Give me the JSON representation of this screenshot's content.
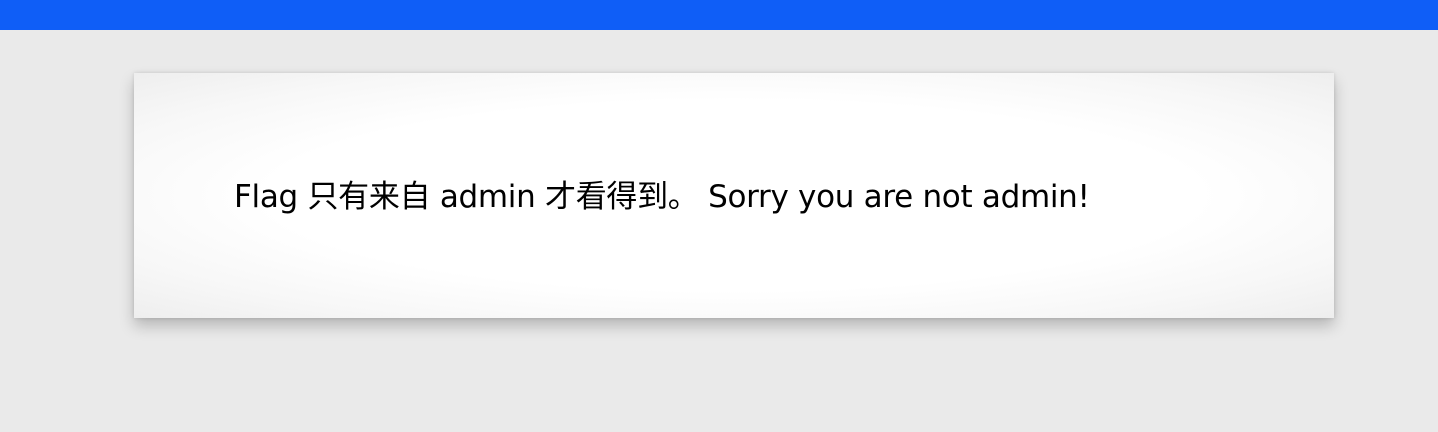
{
  "colors": {
    "top_bar": "#0f5ef7",
    "page_background": "#eaeaea",
    "card_background": "#ffffff",
    "text": "#000000"
  },
  "card": {
    "message": "Flag 只有来自 admin 才看得到。 Sorry you are not admin!"
  }
}
